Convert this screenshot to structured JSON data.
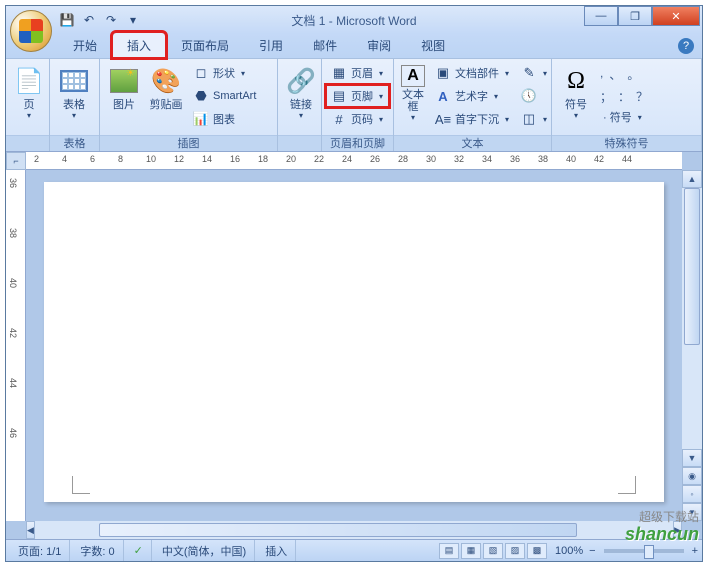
{
  "title": "文档 1 - Microsoft Word",
  "qat": {
    "save": "💾",
    "undo": "↶",
    "redo": "↷",
    "menu": "▾"
  },
  "win": {
    "min": "—",
    "max": "❐",
    "close": "✕"
  },
  "tabs": [
    "开始",
    "插入",
    "页面布局",
    "引用",
    "邮件",
    "审阅",
    "视图"
  ],
  "active_tab": 1,
  "highlighted_tab": 1,
  "ribbon": {
    "pages": {
      "label": "页",
      "group": ""
    },
    "tables": {
      "label": "表格",
      "group": "表格"
    },
    "illustrations": {
      "group": "插图",
      "picture": "图片",
      "clipart": "剪贴画",
      "shapes": "形状",
      "smartart": "SmartArt",
      "chart": "图表"
    },
    "links": {
      "label": "链接",
      "group": ""
    },
    "headerfooter": {
      "group": "页眉和页脚",
      "header": "页眉",
      "footer": "页脚",
      "pagenum": "页码"
    },
    "text": {
      "group": "文本",
      "textbox": "文本框",
      "parts": "文档部件",
      "wordart": "艺术字",
      "dropcap": "首字下沉"
    },
    "symbols": {
      "group": "特殊符号",
      "symbol": "符号",
      "syms": [
        ",",
        "、",
        "。",
        "；",
        "：",
        "？"
      ],
      "more": "· 符号"
    }
  },
  "ruler_h": [
    "2",
    "4",
    "6",
    "8",
    "10",
    "12",
    "14",
    "16",
    "18",
    "20",
    "22",
    "24",
    "26",
    "28",
    "30",
    "32",
    "34",
    "36",
    "38",
    "40",
    "42",
    "44"
  ],
  "ruler_v": [
    "36",
    "38",
    "40",
    "42",
    "44",
    "46"
  ],
  "ruler_corner": "⌐",
  "status": {
    "page": "页面: 1/1",
    "words": "字数: 0",
    "lang": "中文(简体，中国)",
    "mode": "插入",
    "zoom": "100%",
    "check": "✓"
  },
  "watermark": "shancun",
  "watermark2": "超级下载站"
}
